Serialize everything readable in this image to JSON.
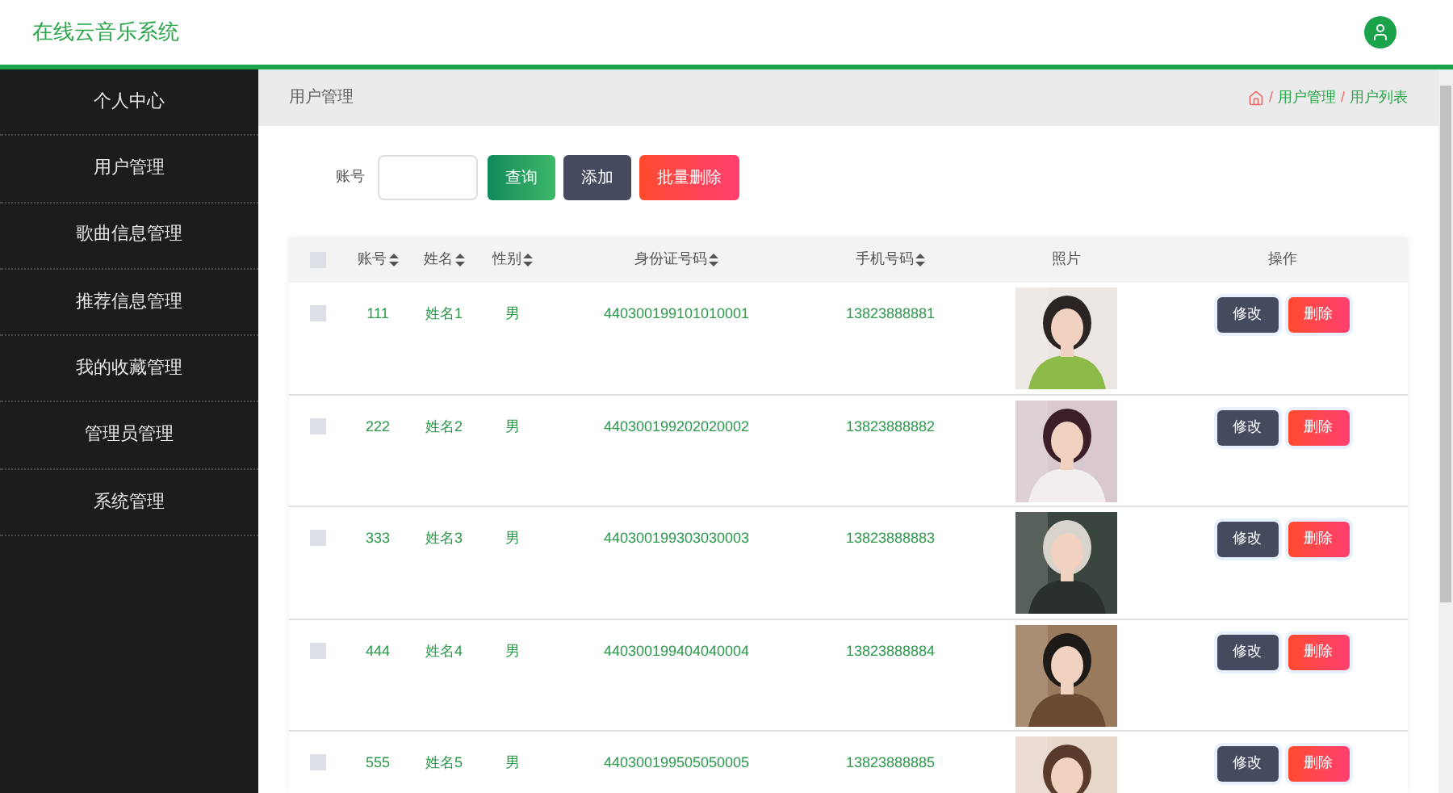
{
  "app_title": "在线云音乐系统",
  "sidebar": {
    "items": [
      {
        "label": "个人中心"
      },
      {
        "label": "用户管理"
      },
      {
        "label": "歌曲信息管理"
      },
      {
        "label": "推荐信息管理"
      },
      {
        "label": "我的收藏管理"
      },
      {
        "label": "管理员管理"
      },
      {
        "label": "系统管理"
      }
    ]
  },
  "page_title": "用户管理",
  "breadcrumb": [
    {
      "separator": "/",
      "label": "用户管理"
    },
    {
      "separator": "/",
      "label": "用户列表"
    }
  ],
  "search": {
    "label": "账号",
    "buttons": [
      {
        "label": "查询",
        "kind": "query"
      },
      {
        "label": "添加",
        "kind": "add"
      },
      {
        "label": "批量删除",
        "kind": "delete"
      }
    ]
  },
  "table": {
    "select_all_checked": false,
    "columns": [
      {
        "label": "账号",
        "sortable": true
      },
      {
        "label": "姓名",
        "sortable": true
      },
      {
        "label": "性别",
        "sortable": true
      },
      {
        "label": "身份证号码",
        "sortable": true
      },
      {
        "label": "手机号码",
        "sortable": true
      },
      {
        "label": "照片",
        "sortable": false
      },
      {
        "label": "操作",
        "sortable": false
      }
    ],
    "rows": [
      {
        "checked": false,
        "account": "111",
        "name": "姓名1",
        "gender": "男",
        "id_number": "440300199101010001",
        "phone": "13823888881",
        "photo": {
          "kind": "picture"
        },
        "actions": [
          "修改",
          "删除"
        ]
      },
      {
        "checked": false,
        "account": "222",
        "name": "姓名2",
        "gender": "男",
        "id_number": "440300199202020002",
        "phone": "13823888882",
        "photo": {
          "kind": "picture"
        },
        "actions": [
          "修改",
          "删除"
        ]
      },
      {
        "checked": false,
        "account": "333",
        "name": "姓名3",
        "gender": "男",
        "id_number": "440300199303030003",
        "phone": "13823888883",
        "photo": {
          "kind": "picture"
        },
        "actions": [
          "修改",
          "删除"
        ]
      },
      {
        "checked": false,
        "account": "444",
        "name": "姓名4",
        "gender": "男",
        "id_number": "440300199404040004",
        "phone": "13823888884",
        "photo": {
          "kind": "picture"
        },
        "actions": [
          "修改",
          "删除"
        ]
      },
      {
        "checked": false,
        "account": "555",
        "name": "姓名5",
        "gender": "男",
        "id_number": "440300199505050005",
        "phone": "13823888885",
        "photo": {
          "kind": "picture"
        },
        "actions": [
          "修改",
          "删除"
        ]
      }
    ]
  }
}
